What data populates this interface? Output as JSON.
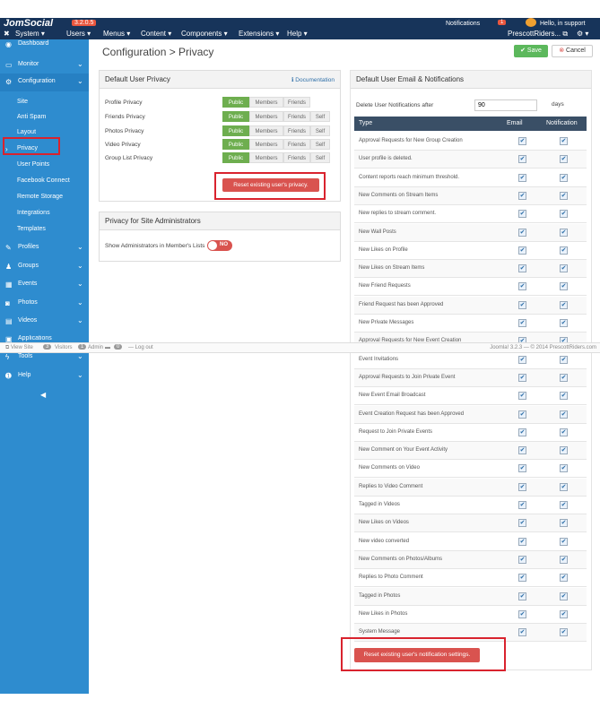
{
  "topbar": {
    "brand": "JomSocial",
    "version": "3.2.0.5",
    "notifications_label": "Notifications",
    "notifications_count": "1",
    "hello": "Hello, in support",
    "user_menu": "PrescottRiders...",
    "menus": [
      "System",
      "Users",
      "Menus",
      "Content",
      "Components",
      "Extensions",
      "Help"
    ]
  },
  "sidebar": {
    "items": [
      {
        "label": "Dashboard",
        "icon": "dashboard-icon"
      },
      {
        "label": "Monitor",
        "icon": "monitor-icon"
      },
      {
        "label": "Configuration",
        "icon": "gears-icon"
      },
      {
        "label": "Site"
      },
      {
        "label": "Anti Spam"
      },
      {
        "label": "Layout"
      },
      {
        "label": "Privacy"
      },
      {
        "label": "User Points"
      },
      {
        "label": "Facebook Connect"
      },
      {
        "label": "Remote Storage"
      },
      {
        "label": "Integrations"
      },
      {
        "label": "Templates"
      },
      {
        "label": "Profiles",
        "icon": "edit-icon"
      },
      {
        "label": "Groups",
        "icon": "users-icon"
      },
      {
        "label": "Events",
        "icon": "calendar-icon"
      },
      {
        "label": "Photos",
        "icon": "camera-icon"
      },
      {
        "label": "Videos",
        "icon": "film-icon"
      },
      {
        "label": "Applications",
        "icon": "apps-icon"
      },
      {
        "label": "Tools",
        "icon": "wrench-icon"
      },
      {
        "label": "Help",
        "icon": "help-icon"
      }
    ]
  },
  "statusbar": {
    "view_site": "View Site",
    "visitors_count": "3",
    "visitors_label": "Visitors",
    "admin_count": "1",
    "admin_label": "Admin",
    "messages_count": "0",
    "logout": "Log out",
    "right": "Joomla! 3.2.3 — © 2014 PrescottRiders.com"
  },
  "page": {
    "title": "Configuration > Privacy",
    "save": "Save",
    "cancel": "Cancel"
  },
  "privacy_panel": {
    "title": "Default User Privacy",
    "doc_link": "Documentation",
    "rows": [
      {
        "label": "Profile Privacy",
        "options": [
          "Public",
          "Members",
          "Friends"
        ]
      },
      {
        "label": "Friends Privacy",
        "options": [
          "Public",
          "Members",
          "Friends",
          "Self"
        ]
      },
      {
        "label": "Photos Privacy",
        "options": [
          "Public",
          "Members",
          "Friends",
          "Self"
        ]
      },
      {
        "label": "Video Privacy",
        "options": [
          "Public",
          "Members",
          "Friends",
          "Self"
        ]
      },
      {
        "label": "Group List Privacy",
        "options": [
          "Public",
          "Members",
          "Friends",
          "Self"
        ]
      }
    ],
    "reset_button": "Reset existing user's privacy."
  },
  "admin_panel": {
    "title": "Privacy for Site Administrators",
    "row_label": "Show Administrators in Member's Lists",
    "toggle": "NO"
  },
  "email_panel": {
    "title": "Default User Email & Notifications",
    "delete_label": "Delete User Notifications after",
    "delete_value": "90",
    "delete_unit": "days",
    "col_type": "Type",
    "col_email": "Email",
    "col_notification": "Notification",
    "rows": [
      "Approval Requests for New Group Creation",
      "User profile is deleted.",
      "Content reports reach minimum threshold.",
      "New Comments on Stream Items",
      "New replies to stream comment.",
      "New Wall Posts",
      "New Likes on Profile",
      "New Likes on Stream Items",
      "New Friend Requests",
      "Friend Request has been Approved",
      "New Private Messages",
      "Approval Requests for New Event Creation",
      "Event Invitations",
      "Approval Requests to Join Private Event",
      "New Event Email Broadcast",
      "Event Creation Request has been Approved",
      "Request to Join Private Events",
      "New Comment on Your Event Activity",
      "New Comments on Video",
      "Replies to Video Comment",
      "Tagged in Videos",
      "New Likes on Videos",
      "New video converted",
      "New Comments on Photos/Albums",
      "Replies to Photo Comment",
      "Tagged in Photos",
      "New Likes in Photos",
      "System Message"
    ],
    "reset_button": "Reset existing user's notification settings."
  }
}
